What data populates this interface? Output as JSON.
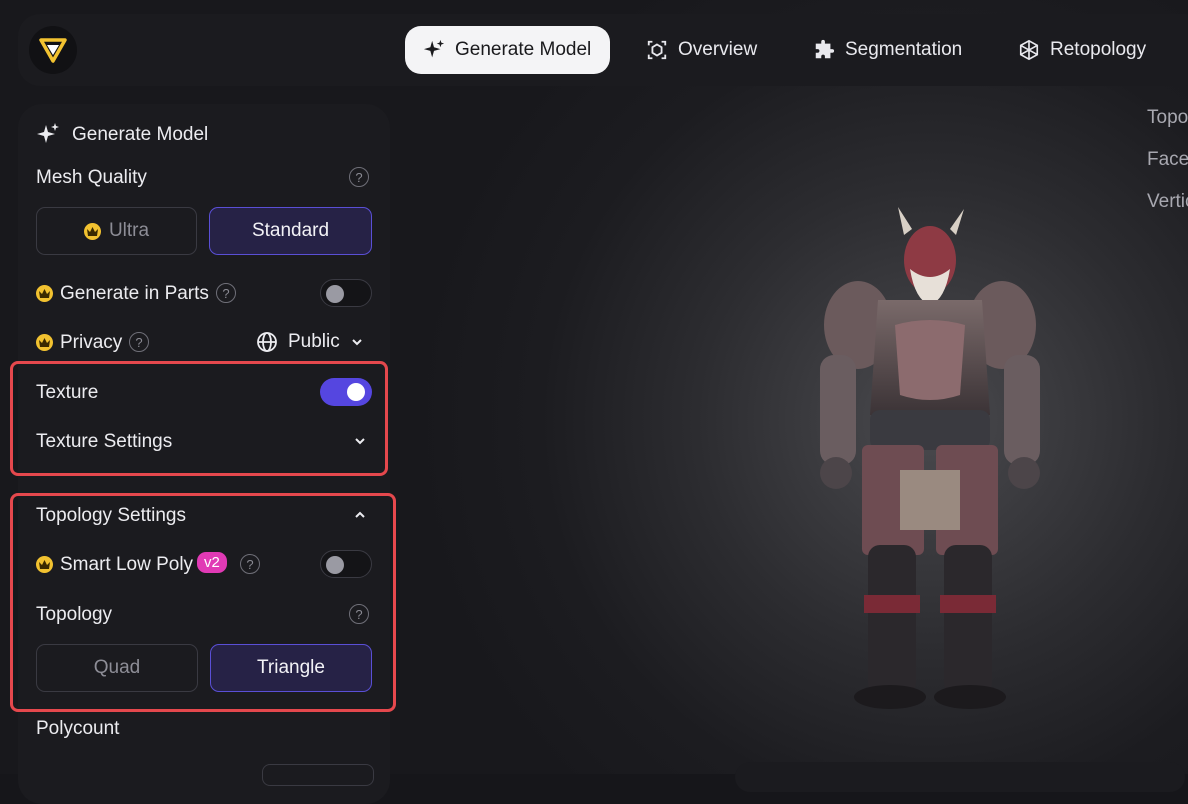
{
  "nav": {
    "items": [
      {
        "label": "Generate Model",
        "icon": "sparkle-icon",
        "active": true
      },
      {
        "label": "Overview",
        "icon": "cube-scan-icon",
        "active": false
      },
      {
        "label": "Segmentation",
        "icon": "puzzle-icon",
        "active": false
      },
      {
        "label": "Retopology",
        "icon": "mesh-icon",
        "active": false
      }
    ]
  },
  "panel": {
    "title": "Generate Model",
    "mesh_quality": {
      "label": "Mesh Quality",
      "options": [
        "Ultra",
        "Standard"
      ],
      "selected": "Standard"
    },
    "generate_in_parts": {
      "label": "Generate in Parts",
      "enabled": false
    },
    "privacy": {
      "label": "Privacy",
      "value": "Public"
    },
    "texture": {
      "label": "Texture",
      "enabled": true
    },
    "texture_settings": {
      "label": "Texture Settings",
      "expanded": false
    },
    "topology_settings": {
      "label": "Topology Settings",
      "expanded": true
    },
    "smart_low_poly": {
      "label": "Smart Low Poly",
      "badge": "v2",
      "enabled": false
    },
    "topology": {
      "label": "Topology",
      "options": [
        "Quad",
        "Triangle"
      ],
      "selected": "Triangle"
    },
    "polycount": {
      "label": "Polycount"
    }
  },
  "stats": {
    "topology": "Topo",
    "faces": "Faces",
    "vertices": "Vertic"
  },
  "colors": {
    "accent": "#5546e0",
    "highlight": "#e5484d",
    "crown": "#f2c230",
    "badge": "#e13ab5"
  }
}
